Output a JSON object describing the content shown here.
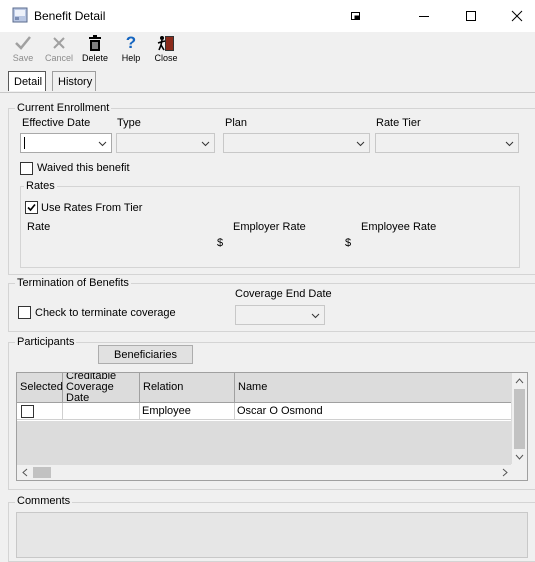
{
  "window": {
    "title": "Benefit Detail",
    "controls": {
      "restore": "restore-icon",
      "minimize": "minimize-icon",
      "maximize": "maximize-icon",
      "close": "close-icon"
    }
  },
  "toolbar": {
    "save": {
      "label": "Save",
      "icon": "checkmark-icon",
      "enabled": false
    },
    "cancel": {
      "label": "Cancel",
      "icon": "x-icon",
      "enabled": false
    },
    "delete": {
      "label": "Delete",
      "icon": "trash-icon",
      "enabled": true
    },
    "help": {
      "label": "Help",
      "icon": "question-icon",
      "enabled": true
    },
    "close": {
      "label": "Close",
      "icon": "exit-door-icon",
      "enabled": true
    }
  },
  "tabs": [
    {
      "label": "Detail",
      "active": true
    },
    {
      "label": "History",
      "active": false
    }
  ],
  "enrollment": {
    "legend": "Current Enrollment",
    "effective_date": {
      "label": "Effective Date",
      "value": ""
    },
    "type": {
      "label": "Type",
      "value": ""
    },
    "plan": {
      "label": "Plan",
      "value": ""
    },
    "rate_tier": {
      "label": "Rate Tier",
      "value": ""
    },
    "waived": {
      "label": "Waived this benefit",
      "checked": false
    },
    "rates": {
      "legend": "Rates",
      "use_rates_from_tier": {
        "label": "Use Rates From Tier",
        "checked": true
      },
      "rate_label": "Rate",
      "employer_rate": {
        "label": "Employer Rate",
        "currency": "$"
      },
      "employee_rate": {
        "label": "Employee Rate",
        "currency": "$"
      }
    }
  },
  "termination": {
    "legend": "Termination of Benefits",
    "check_terminate": {
      "label": "Check to terminate coverage",
      "checked": false
    },
    "coverage_end_date": {
      "label": "Coverage End Date",
      "value": ""
    }
  },
  "participants": {
    "legend": "Participants",
    "beneficiaries_button": "Beneficiaries",
    "columns": [
      "Selected",
      "Creditable Coverage Date",
      "Relation",
      "Name"
    ],
    "rows": [
      {
        "selected": false,
        "creditable_coverage_date": "",
        "relation": "Employee",
        "name": "Oscar O Osmond"
      }
    ]
  },
  "comments": {
    "legend": "Comments",
    "value": ""
  }
}
